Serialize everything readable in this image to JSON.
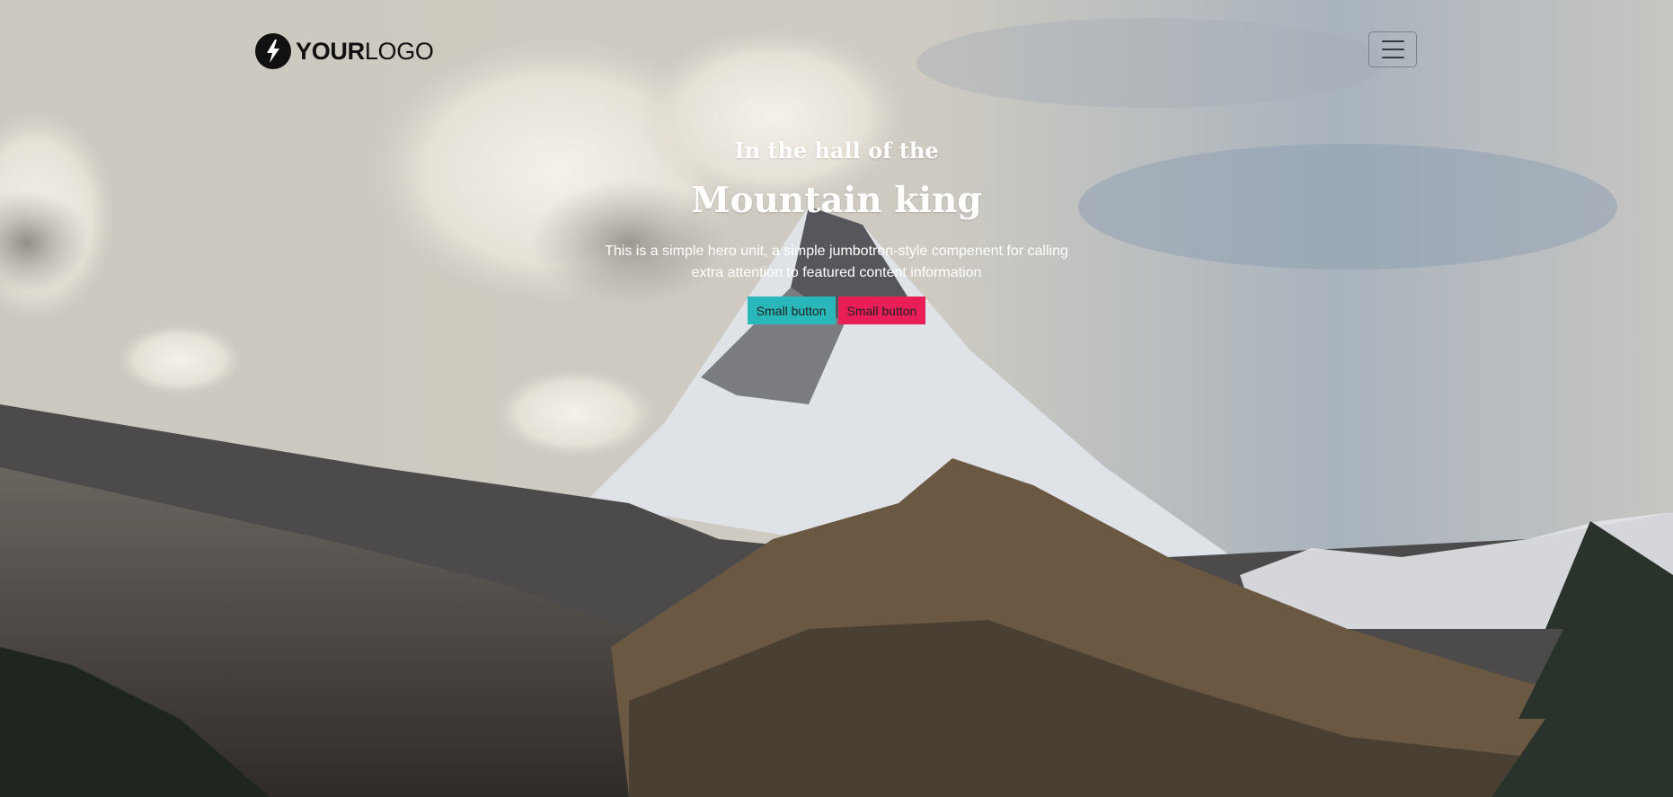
{
  "header": {
    "logo": {
      "icon": "lightning-bolt-icon",
      "text_strong": "YOUR",
      "text_light": "LOGO"
    },
    "menu_toggle": {
      "icon": "hamburger-menu-icon"
    }
  },
  "hero": {
    "kicker": "In the hall of the",
    "title": "Mountain king",
    "lead": "This is a simple hero unit, a simple jumbotron-style compenent for calling extra attention to featured content information",
    "buttons": [
      {
        "label": "Small button",
        "color": "#2ab7b9"
      },
      {
        "label": "Small button",
        "color": "#e91e56"
      }
    ]
  }
}
